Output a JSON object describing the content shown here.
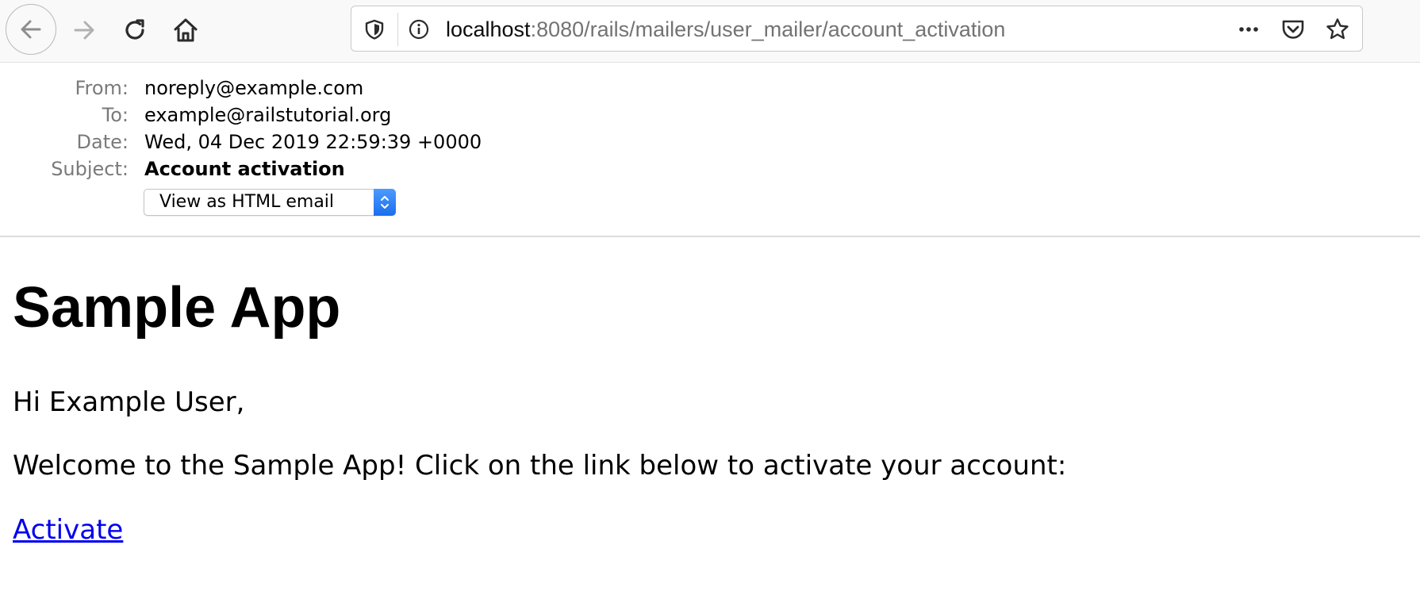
{
  "browser": {
    "url_host": "localhost",
    "url_path": ":8080/rails/mailers/user_mailer/account_activation",
    "icons": {
      "back": "back-arrow-icon",
      "forward": "forward-arrow-icon",
      "reload": "reload-icon",
      "home": "home-icon",
      "tracking": "shield-icon",
      "site_info": "info-icon",
      "page_actions": "more-icon",
      "pocket": "pocket-icon",
      "bookmark": "star-icon"
    }
  },
  "mail_header": {
    "from_label": "From:",
    "from_value": "noreply@example.com",
    "to_label": "To:",
    "to_value": "example@railstutorial.org",
    "date_label": "Date:",
    "date_value": "Wed, 04 Dec 2019 22:59:39 +0000",
    "subject_label": "Subject:",
    "subject_value": "Account activation",
    "format_selected": "View as HTML email"
  },
  "email": {
    "title": "Sample App",
    "greeting": "Hi Example User,",
    "welcome": "Welcome to the Sample App! Click on the link below to activate your account:",
    "link_text": "Activate"
  },
  "colors": {
    "link": "#0000ee",
    "select_accent": "#1a6fee",
    "label_gray": "#7a7a7a"
  }
}
